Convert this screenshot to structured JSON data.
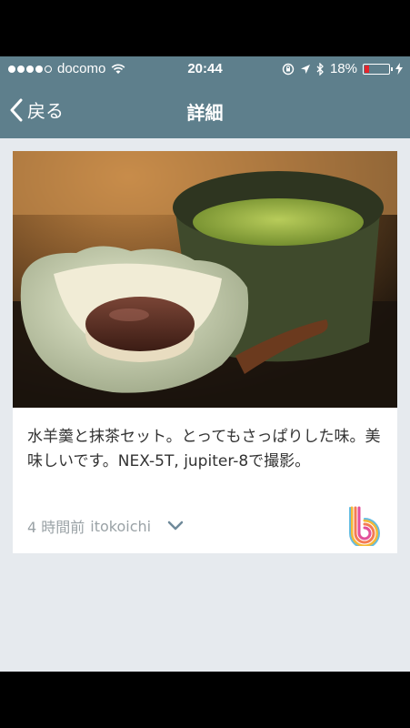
{
  "status": {
    "carrier": "docomo",
    "time": "20:44",
    "battery": "18%",
    "battery_level": 0.18
  },
  "nav": {
    "back_label": "戻る",
    "title": "詳細"
  },
  "post": {
    "text": "水羊羹と抹茶セット。とってもさっぱりした味。美味しいです。NEX-5T, jupiter-8で撮影。",
    "time_ago": "4 時間前",
    "author": "itokoichi"
  },
  "icons": {
    "signal": "signal-dots-icon",
    "wifi": "wifi-icon",
    "lock_rotation": "rotation-lock-icon",
    "location": "location-arrow-icon",
    "bluetooth": "bluetooth-icon",
    "battery": "battery-icon",
    "charging": "charging-bolt-icon",
    "back": "chevron-left-icon",
    "expand": "chevron-down-icon",
    "brand": "rainbow-b-logo"
  },
  "colors": {
    "navbar": "#5e7f8c",
    "background": "#e6eaee",
    "battery_low": "#e4252c"
  }
}
